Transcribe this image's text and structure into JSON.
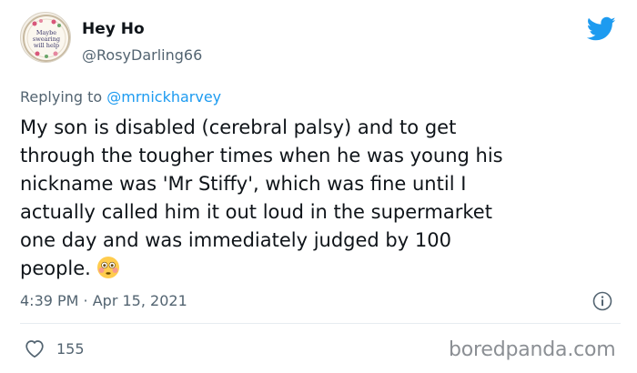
{
  "author": {
    "display_name": "Hey Ho",
    "handle": "@RosyDarling66",
    "avatar_text": "Maybe swearing will help",
    "avatar_icon": "embroidery-hoop-avatar"
  },
  "reply": {
    "prefix": "Replying to ",
    "mention": "@mrnickharvey"
  },
  "tweet": {
    "text": "My son is disabled (cerebral palsy) and to get\nthrough the tougher times when he was young his\nnickname was 'Mr Stiffy', which was fine until I\nactually called him it out loud in the supermarket\none day and was immediately judged by 100\npeople.",
    "emoji": "flushed-face-emoji"
  },
  "meta": {
    "timestamp": "4:39 PM · Apr 15, 2021"
  },
  "engagement": {
    "likes": "155"
  },
  "watermark": "boredpanda.com",
  "colors": {
    "brand": "#1d9bf0",
    "text": "#0f1419",
    "secondary": "#536471",
    "divider": "#e6ecf0"
  },
  "icons": {
    "logo": "twitter-bird-icon",
    "info": "info-icon",
    "like": "heart-icon"
  }
}
